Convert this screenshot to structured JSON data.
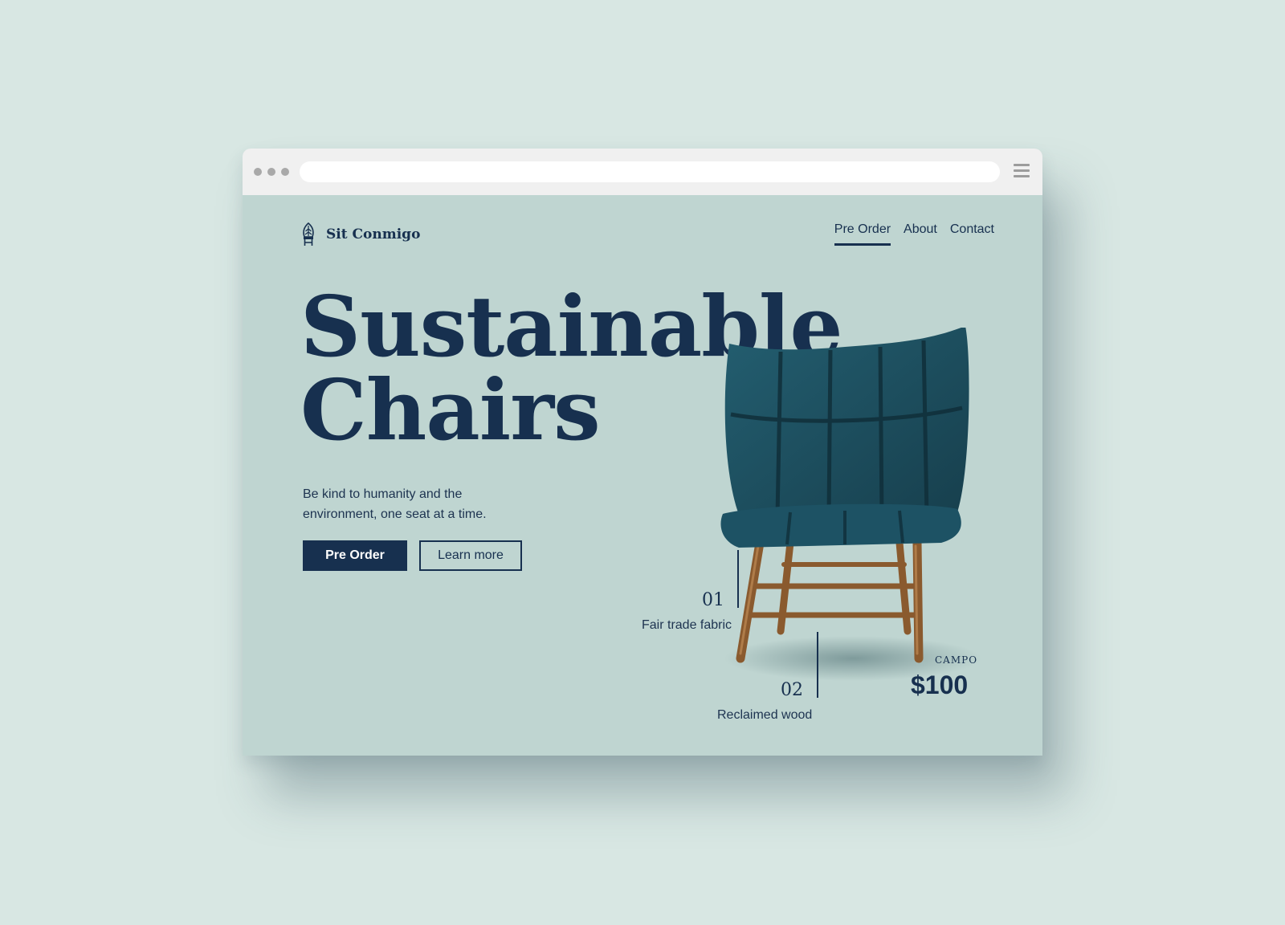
{
  "brand": {
    "name": "Sit Conmigo",
    "logo_icon": "chair-leaf-icon"
  },
  "nav": {
    "items": [
      {
        "label": "Pre Order",
        "active": true
      },
      {
        "label": "About",
        "active": false
      },
      {
        "label": "Contact",
        "active": false
      }
    ]
  },
  "hero": {
    "headline_line1": "Sustainable",
    "headline_line2": "Chairs",
    "tagline": "Be kind to humanity and the environment, one seat at a time.",
    "primary_button": "Pre Order",
    "secondary_button": "Learn more"
  },
  "features": [
    {
      "number": "01",
      "label": "Fair trade fabric"
    },
    {
      "number": "02",
      "label": "Reclaimed wood"
    }
  ],
  "product": {
    "name": "CAMPO",
    "price": "$100"
  },
  "colors": {
    "background": "#d8e7e3",
    "page": "#bfd5d1",
    "navy": "#17304f",
    "chair_fabric": "#1f5566",
    "chair_wood": "#a06f3c"
  },
  "browser": {
    "menu_icon": "hamburger-icon"
  }
}
